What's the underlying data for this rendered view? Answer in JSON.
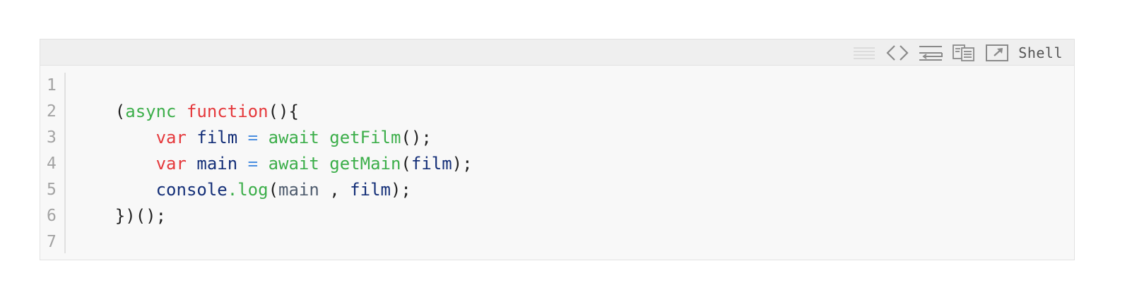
{
  "toolbar": {
    "language": "Shell",
    "icons": [
      "view-source-icon",
      "code-icon",
      "wrap-lines-icon",
      "copy-icon",
      "open-new-window-icon"
    ]
  },
  "code": {
    "line_numbers": [
      "1",
      "2",
      "3",
      "4",
      "5",
      "6",
      "7"
    ],
    "lines": [
      [],
      [
        {
          "t": "    ",
          "c": "plain"
        },
        {
          "t": "(",
          "c": "plain"
        },
        {
          "t": "async",
          "c": "fn"
        },
        {
          "t": " ",
          "c": "plain"
        },
        {
          "t": "function",
          "c": "kw"
        },
        {
          "t": "(){",
          "c": "plain"
        }
      ],
      [
        {
          "t": "        ",
          "c": "plain"
        },
        {
          "t": "var",
          "c": "kw"
        },
        {
          "t": " ",
          "c": "plain"
        },
        {
          "t": "film",
          "c": "var"
        },
        {
          "t": " ",
          "c": "plain"
        },
        {
          "t": "=",
          "c": "op"
        },
        {
          "t": " ",
          "c": "plain"
        },
        {
          "t": "await",
          "c": "fn"
        },
        {
          "t": " ",
          "c": "plain"
        },
        {
          "t": "getFilm",
          "c": "fn"
        },
        {
          "t": "();",
          "c": "plain"
        }
      ],
      [
        {
          "t": "        ",
          "c": "plain"
        },
        {
          "t": "var",
          "c": "kw"
        },
        {
          "t": " ",
          "c": "plain"
        },
        {
          "t": "main",
          "c": "var"
        },
        {
          "t": " ",
          "c": "plain"
        },
        {
          "t": "=",
          "c": "op"
        },
        {
          "t": " ",
          "c": "plain"
        },
        {
          "t": "await",
          "c": "fn"
        },
        {
          "t": " ",
          "c": "plain"
        },
        {
          "t": "getMain",
          "c": "fn"
        },
        {
          "t": "(",
          "c": "plain"
        },
        {
          "t": "film",
          "c": "var"
        },
        {
          "t": ");",
          "c": "plain"
        }
      ],
      [
        {
          "t": "        ",
          "c": "plain"
        },
        {
          "t": "console",
          "c": "var"
        },
        {
          "t": ".",
          "c": "fn"
        },
        {
          "t": "log",
          "c": "fn"
        },
        {
          "t": "(",
          "c": "plain"
        },
        {
          "t": "main",
          "c": "gray"
        },
        {
          "t": " , ",
          "c": "plain"
        },
        {
          "t": "film",
          "c": "var"
        },
        {
          "t": ");",
          "c": "plain"
        }
      ],
      [
        {
          "t": "    ",
          "c": "plain"
        },
        {
          "t": "})();",
          "c": "plain"
        }
      ],
      []
    ]
  },
  "colors": {
    "keyword": "#e5383b",
    "function": "#3cae4a",
    "identifier": "#142f78",
    "operator": "#4a8ee0",
    "line_number": "#a3a3a3",
    "background": "#f8f8f8",
    "toolbar_background": "#efefef"
  }
}
